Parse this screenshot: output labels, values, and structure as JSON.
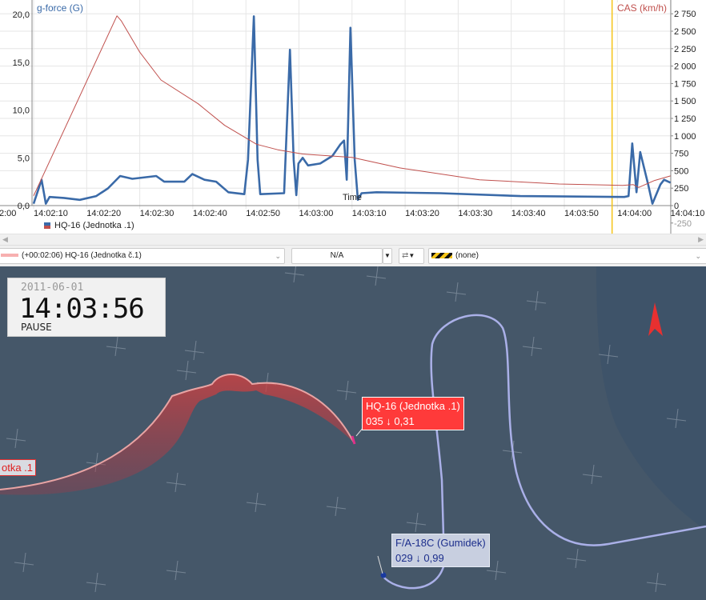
{
  "chart": {
    "left_axis_title": "g-force (G)",
    "right_axis_title": "CAS (km/h)",
    "x_title": "Time",
    "legend_label": "HQ-16 (Jednotka .1)",
    "colors": {
      "gforce": "#3a6aa8",
      "cas": "#c0504d",
      "cursor": "#f5c518"
    }
  },
  "chart_data": {
    "type": "line",
    "xlabel": "Time",
    "x_ticks": [
      "2:00",
      "14:02:10",
      "14:02:20",
      "14:02:30",
      "14:02:40",
      "14:02:50",
      "14:03:00",
      "14:03:10",
      "14:03:20",
      "14:03:30",
      "14:03:40",
      "14:03:50",
      "14:04:00",
      "14:04:10"
    ],
    "x_range_seconds_after_14_02_00": [
      -6,
      130
    ],
    "cursor_seconds_after_14_02_00": 119,
    "left_axis": {
      "label": "g-force (G)",
      "ticks": [
        "0,0",
        "5,0",
        "10,0",
        "15,0",
        "20,0"
      ],
      "range": [
        0,
        20
      ]
    },
    "right_axis": {
      "label": "CAS (km/h)",
      "ticks": [
        "-250",
        "0",
        "250",
        "500",
        "750",
        "1 000",
        "1 250",
        "1 500",
        "1 750",
        "2 000",
        "2 250",
        "2 500",
        "2 750"
      ],
      "range": [
        0,
        2750
      ]
    },
    "series": [
      {
        "name": "g-force",
        "axis": "left",
        "t": [
          10,
          11.5,
          12.3,
          13,
          15.7,
          18.7,
          21.8,
          24,
          26.3,
          28.6,
          33.1,
          34.6,
          38.4,
          39.9,
          42.2,
          44.4,
          46.7,
          49.7,
          50.4,
          51.5,
          52.2,
          52.7,
          57.2,
          58.3,
          59,
          59.5,
          59.9,
          60.7,
          61.7,
          64,
          66.3,
          67.8,
          68.5,
          69,
          69.7,
          70.5,
          71.1,
          71.8,
          74.6,
          86.6,
          101.7,
          121.3,
          122.1,
          122.8,
          123.6,
          124.3,
          125.8,
          126.6,
          128.1,
          128.8,
          130
        ],
        "values": [
          0.2,
          2.7,
          0.2,
          0.9,
          0.8,
          0.6,
          1.0,
          1.8,
          3.1,
          2.8,
          3.1,
          2.5,
          2.5,
          3.3,
          2.7,
          2.5,
          1.4,
          1.2,
          4.8,
          19.8,
          4.8,
          1.2,
          1.3,
          16.3,
          4.8,
          1.1,
          4.4,
          5.0,
          4.2,
          4.4,
          5.2,
          6.4,
          6.8,
          2.7,
          18.6,
          4.8,
          0.6,
          1.3,
          1.4,
          1.3,
          1.0,
          0.9,
          1.0,
          6.5,
          1.4,
          5.6,
          2.2,
          0.2,
          2.2,
          2.7,
          2.4
        ]
      },
      {
        "name": "CAS",
        "axis": "right",
        "t": [
          10,
          25.7,
          26.5,
          30,
          34,
          41,
          46,
          52,
          56,
          60.7,
          70,
          79,
          94,
          109,
          121,
          123,
          124,
          127,
          130
        ],
        "values": [
          140,
          2720,
          2650,
          2200,
          1800,
          1460,
          1150,
          880,
          800,
          740,
          690,
          540,
          370,
          310,
          290,
          300,
          260,
          360,
          425
        ]
      }
    ]
  },
  "toolbar": {
    "track_select": "(+00:02:06) HQ-16 (Jednotka č.1)",
    "value_field": "N/A",
    "pattern_select": "(none)"
  },
  "map": {
    "date": "2011-06-01",
    "time": "14:03:56",
    "state": "PAUSE",
    "hq16_label": "HQ-16 (Jednotka .1)",
    "hq16_info": "035 ↓ 0,31",
    "offscreen_label": "otka .1",
    "fa18_label": "F/A-18C (Gumidek)",
    "fa18_info": "029 ↓ 0,99",
    "colors": {
      "hq16": "#ff3a3a",
      "fa18": "#aab0e8",
      "background": "#455769"
    }
  }
}
